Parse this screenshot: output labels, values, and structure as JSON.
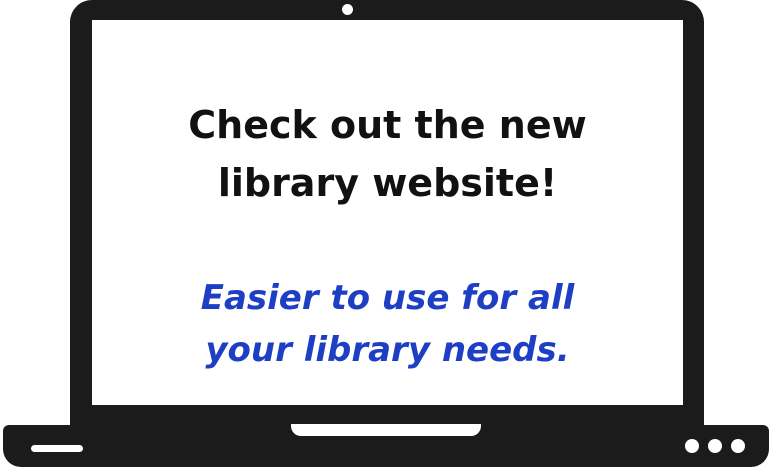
{
  "headline": {
    "line1": "Check out the new",
    "line2": "library website!"
  },
  "tagline": {
    "line1": "Easier to use for all",
    "line2": "your library needs."
  },
  "colors": {
    "device": "#1b1b1b",
    "screen": "#ffffff",
    "headline_text": "#111111",
    "tagline_text": "#1e3fc4"
  },
  "icons": {
    "camera": "webcam-dot",
    "base_slot": "port-slot",
    "base_dots": "indicator-lights"
  }
}
